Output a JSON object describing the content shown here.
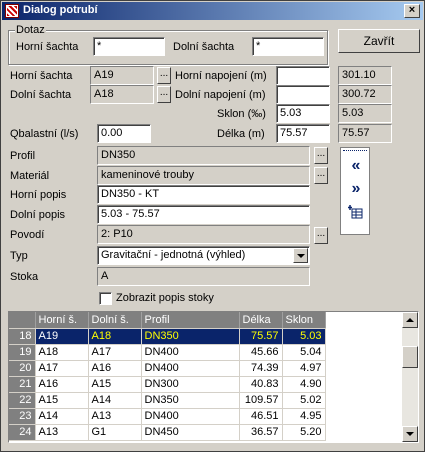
{
  "window": {
    "title": "Dialog potrubí",
    "close_glyph": "×"
  },
  "query": {
    "group_label": "Dotaz",
    "upper_label": "Horní šachta",
    "upper_value": "*",
    "lower_label": "Dolní šachta",
    "lower_value": "*"
  },
  "close_button": "Zavřít",
  "form": {
    "horni_sachta_label": "Horní šachta",
    "horni_sachta": "A19",
    "dolni_sachta_label": "Dolní šachta",
    "dolni_sachta": "A18",
    "horni_napojeni_label": "Horní napojení (m)",
    "horni_napojeni": "",
    "horni_napojeni_calc": "301.10",
    "dolni_napojeni_label": "Dolní napojení (m)",
    "dolni_napojeni": "",
    "dolni_napojeni_calc": "300.72",
    "sklon_label": "Sklon (‰)",
    "sklon": "5.03",
    "sklon_calc": "5.03",
    "qbalast_label": "Qbalastní (l/s)",
    "qbalast": "0.00",
    "delka_label": "Délka (m)",
    "delka": "75.57",
    "delka_calc": "75.57",
    "profil_label": "Profil",
    "profil": "DN350",
    "material_label": "Materiál",
    "material": "kameninové trouby",
    "horni_popis_label": "Horní popis",
    "horni_popis": "DN350 - KT",
    "dolni_popis_label": "Dolní popis",
    "dolni_popis": "5.03 - 75.57",
    "povodi_label": "Povodí",
    "povodi": "2: P10",
    "typ_label": "Typ",
    "typ": "Gravitační - jednotná (výhled)",
    "stoka_label": "Stoka",
    "stoka": "A",
    "show_label": "Zobrazit popis stoky",
    "ellipsis": "..."
  },
  "nav": {
    "prev": "«",
    "next": "»"
  },
  "table": {
    "headers": [
      "",
      "Horní š.",
      "Dolní š.",
      "Profil",
      "Délka",
      "Sklon"
    ],
    "rows": [
      [
        "18",
        "A19",
        "A18",
        "DN350",
        "75.57",
        "5.03"
      ],
      [
        "19",
        "A18",
        "A17",
        "DN400",
        "45.66",
        "5.04"
      ],
      [
        "20",
        "A17",
        "A16",
        "DN400",
        "74.39",
        "4.97"
      ],
      [
        "21",
        "A16",
        "A15",
        "DN300",
        "40.83",
        "4.90"
      ],
      [
        "22",
        "A15",
        "A14",
        "DN350",
        "109.57",
        "5.02"
      ],
      [
        "23",
        "A14",
        "A13",
        "DN400",
        "46.51",
        "4.95"
      ],
      [
        "24",
        "A13",
        "G1",
        "DN450",
        "36.57",
        "5.20"
      ]
    ],
    "selected_row": 0
  },
  "colors": {
    "selection": "#0a246a",
    "title_start": "#0a246a",
    "title_end": "#a6caf0",
    "highlight_text": "#ffff00"
  }
}
